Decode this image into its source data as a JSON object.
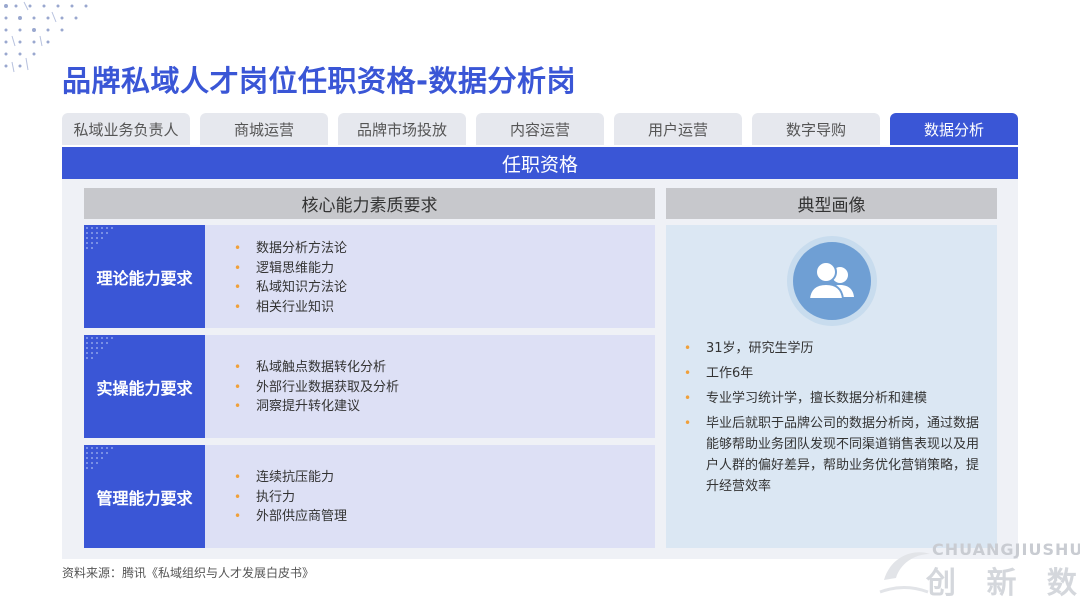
{
  "title": "品牌私域人才岗位任职资格-数据分析岗",
  "tabs": [
    {
      "label": "私域业务负责人",
      "active": false
    },
    {
      "label": "商城运营",
      "active": false
    },
    {
      "label": "品牌市场投放",
      "active": false
    },
    {
      "label": "内容运营",
      "active": false
    },
    {
      "label": "用户运营",
      "active": false
    },
    {
      "label": "数字导购",
      "active": false
    },
    {
      "label": "数据分析",
      "active": true
    }
  ],
  "section_title": "任职资格",
  "left_header": "核心能力素质要求",
  "right_header": "典型画像",
  "competencies": [
    {
      "label": "理论能力要求",
      "items": [
        "数据分析方法论",
        "逻辑思维能力",
        "私域知识方法论",
        "相关行业知识"
      ]
    },
    {
      "label": "实操能力要求",
      "items": [
        "私域触点数据转化分析",
        "外部行业数据获取及分析",
        "洞察提升转化建议"
      ]
    },
    {
      "label": "管理能力要求",
      "items": [
        "连续抗压能力",
        "执行力",
        "外部供应商管理"
      ]
    }
  ],
  "profile": {
    "icon": "users-icon",
    "items": [
      "31岁，研究生学历",
      "工作6年",
      "专业学习统计学，擅长数据分析和建模",
      "毕业后就职于品牌公司的数据分析岗，通过数据能够帮助业务团队发现不同渠道销售表现以及用户人群的偏好差异，帮助业务优化营销策略，提升经营效率"
    ]
  },
  "source": "资料来源：腾讯《私域组织与人才发展白皮书》",
  "watermark": {
    "latin": "CHUANGJIUSHU",
    "cjk": "创 新 数"
  },
  "colors": {
    "primary": "#3a56d6",
    "bullet": "#f0a03a",
    "header_gray": "#c7c8cc",
    "row_bg": "#dde0f5",
    "profile_bg": "#dbe7f3",
    "avatar": "#6f9fd4"
  }
}
